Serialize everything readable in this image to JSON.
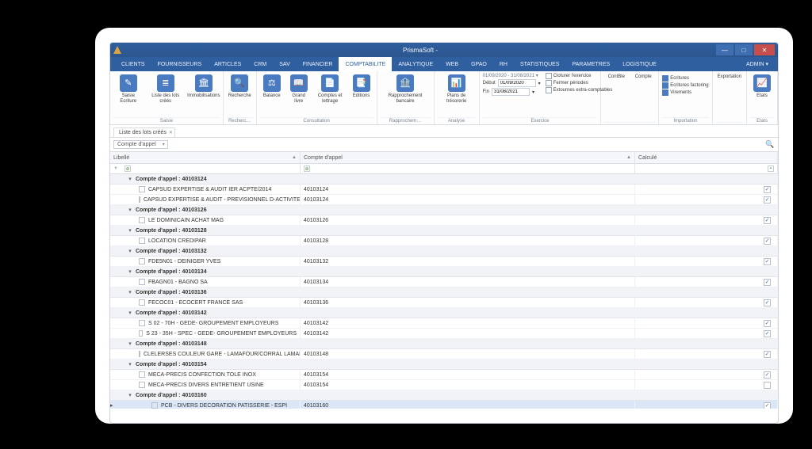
{
  "app": {
    "title": "PrismaSoft -",
    "admin": "ADMIN ▾"
  },
  "window_buttons": {
    "min": "—",
    "max": "□",
    "close": "✕"
  },
  "tabs": {
    "items": [
      "CLIENTS",
      "FOURNISSEURS",
      "ARTICLES",
      "CRM",
      "SAV",
      "FINANCIER",
      "COMPTABILITE",
      "ANALYTIQUE",
      "WEB",
      "GPAO",
      "RH",
      "STATISTIQUES",
      "PARAMETRES",
      "LOGISTIQUE"
    ],
    "active_index": 6
  },
  "ribbon": {
    "g_saisie": {
      "cap": "Saisie",
      "b1": "Saisie Ecriture",
      "b2": "Liste des lots créés",
      "b3": "Immobilisations"
    },
    "g_rech": {
      "cap": "Recherc…",
      "b1": "Recherche"
    },
    "g_consult": {
      "cap": "Consultation",
      "b1": "Balance",
      "b2": "Grand livre",
      "b3": "Comptes et lettrage",
      "b4": "Editions"
    },
    "g_rappr": {
      "cap": "Rapprochem…",
      "b1": "Rapprochement bancaire"
    },
    "g_analyse": {
      "cap": "Analyse",
      "b1": "Plans de trésorerie"
    },
    "g_exo": {
      "cap": "Exercice",
      "range": "01/09/2020 - 31/08/2021 ▾",
      "debut_lbl": "Début",
      "debut_val": "01/09/2020",
      "fin_lbl": "Fin",
      "fin_val": "31/08/2021",
      "c1": "Cloturer l'exercice",
      "c2": "Fermer périodes",
      "c3": "Extournes extra-comptables"
    },
    "g_contg": {
      "b1": "ContBle",
      "b2": "Compte"
    },
    "g_import": {
      "cap": "Importation",
      "l1": "Ecritures",
      "l2": "Ecritures factoring",
      "l3": "Virements"
    },
    "g_export": {
      "b1": "Exportation"
    },
    "g_etats": {
      "cap": "Etats",
      "b1": "Etats"
    }
  },
  "doctab": {
    "label": "Liste des lots créés"
  },
  "query_dropdown": "Compte d'appel",
  "columns": {
    "lib": "Libellé",
    "cpt": "Compte d'appel",
    "cal": "Calculé"
  },
  "groups": [
    {
      "title": "Compte d'appel : 40103124",
      "rows": [
        {
          "lib": "CAPSUD EXPERTISE & AUDIT  IER ACPTE/2014",
          "cpt": "40103124",
          "cal": true
        },
        {
          "lib": "CAPSUD EXPERTISE & AUDIT - PREVISIONNEL D-ACTIVITE",
          "cpt": "40103124",
          "cal": true
        }
      ]
    },
    {
      "title": "Compte d'appel : 40103126",
      "rows": [
        {
          "lib": "LE DOMINICAIN ACHAT MAG",
          "cpt": "40103126",
          "cal": true
        }
      ]
    },
    {
      "title": "Compte d'appel : 40103128",
      "rows": [
        {
          "lib": "LOCATION CREDIPAR",
          "cpt": "40103128",
          "cal": true
        }
      ]
    },
    {
      "title": "Compte d'appel : 40103132",
      "rows": [
        {
          "lib": "FDE5N01    - DEINIGER YVES",
          "cpt": "40103132",
          "cal": true
        }
      ]
    },
    {
      "title": "Compte d'appel : 40103134",
      "rows": [
        {
          "lib": "FBAGN01     - BAGNO SA",
          "cpt": "40103134",
          "cal": true
        }
      ]
    },
    {
      "title": "Compte d'appel : 40103136",
      "rows": [
        {
          "lib": "FECOC01    - ECOCERT FRANCE SAS",
          "cpt": "40103136",
          "cal": true
        }
      ]
    },
    {
      "title": "Compte d'appel : 40103142",
      "rows": [
        {
          "lib": "S 02 - 70H - GEDE- GROUPEMENT EMPLOYEURS",
          "cpt": "40103142",
          "cal": true
        },
        {
          "lib": "S 23 - 35H - SPEC - GEDE- GROUPEMENT EMPLOYEURS",
          "cpt": "40103142",
          "cal": true
        }
      ]
    },
    {
      "title": "Compte d'appel : 40103148",
      "rows": [
        {
          "lib": "CLELERSES COULEUR GARE - LAMAFOUR/CORRAL  LAMAFOUR/CORRAL …",
          "cpt": "40103148",
          "cal": true
        }
      ]
    },
    {
      "title": "Compte d'appel : 40103154",
      "rows": [
        {
          "lib": "MECA-PRECIS  CONFECTION TOLE INOX",
          "cpt": "40103154",
          "cal": true
        },
        {
          "lib": "MECA-PRECIS DIVERS ENTRETIENT USINE",
          "cpt": "40103154",
          "cal": false
        }
      ]
    },
    {
      "title": "Compte d'appel : 40103160",
      "rows": [
        {
          "lib": "PCB - DIVERS DECORATION PATISSERIE - ESPI",
          "cpt": "40103160",
          "cal": true,
          "selected": true
        }
      ]
    }
  ]
}
